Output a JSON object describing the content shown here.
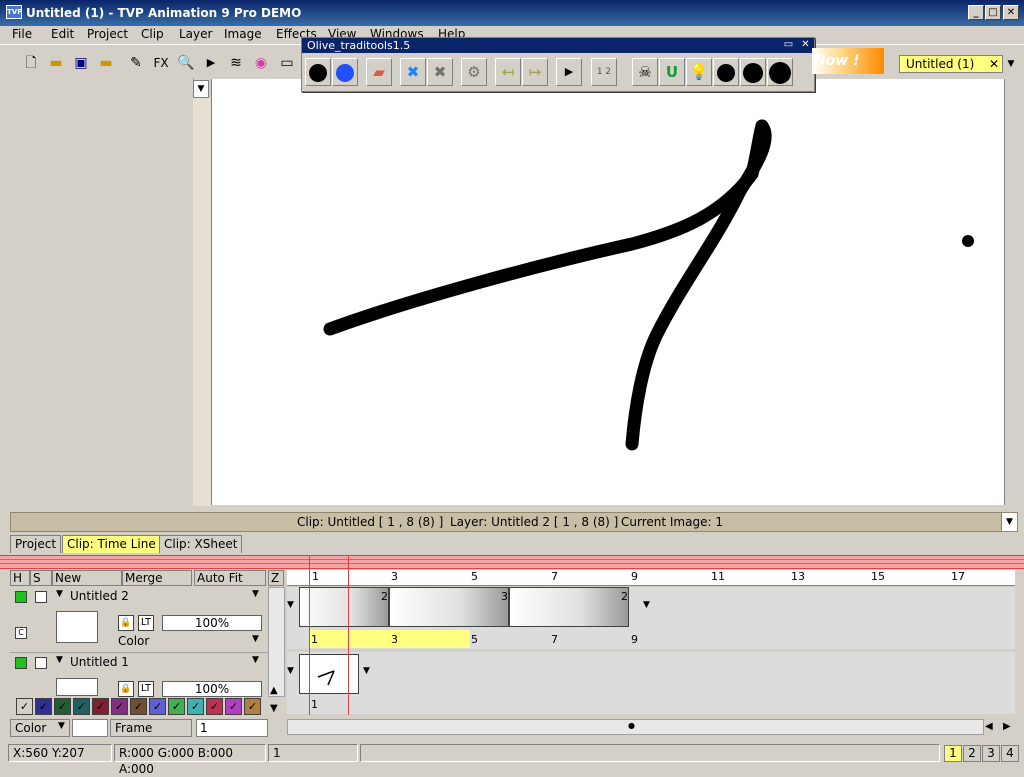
{
  "window": {
    "title": "Untitled (1) - TVP Animation 9 Pro DEMO",
    "app_icon": "TVP"
  },
  "menu": [
    "File",
    "Edit",
    "Project",
    "Clip",
    "Layer",
    "Image",
    "Effects",
    "View",
    "Windows",
    "Help"
  ],
  "toolbar": {
    "fx_label": "FX"
  },
  "float_window": {
    "title": "Olive_traditools1.5"
  },
  "promo": {
    "text": "Now !"
  },
  "project_tab": {
    "label": "Untitled (1)",
    "close": "✕"
  },
  "status": {
    "clip": "Clip: Untitled [ 1 , 8  (8) ]",
    "layer": "Layer: Untitled 2 [ 1 , 8  (8) ]",
    "current": "Current Image: 1"
  },
  "tabs": [
    "Project",
    "Clip: Time Line",
    "Clip: XSheet"
  ],
  "columns": {
    "h": "H",
    "s": "S",
    "new": "New",
    "merge": "Merge",
    "autofit": "Auto Fit",
    "z": "Z"
  },
  "ruler": [
    "1",
    "3",
    "5",
    "7",
    "9",
    "11",
    "13",
    "15",
    "17"
  ],
  "layers": [
    {
      "name": "Untitled 2",
      "opacity": "100%",
      "mode": "Color",
      "lock": "LT",
      "badge": "C",
      "frames": [
        {
          "label": "2"
        },
        {
          "label": "3"
        },
        {
          "label": "2"
        }
      ],
      "numbers": [
        "1",
        "3",
        "5",
        "7",
        "9"
      ]
    },
    {
      "name": "Untitled 1",
      "opacity": "100%",
      "lock": "LT",
      "frame_number": "1"
    }
  ],
  "palette_checks": "✓",
  "bottom_controls": {
    "color_label": "Color",
    "frame_label": "Frame",
    "frame_value": "1"
  },
  "bottom_status": {
    "xy": "X:560  Y:207",
    "rgba": "R:000 G:000 B:000 A:000",
    "value": "1",
    "pages": [
      "1",
      "2",
      "3",
      "4"
    ]
  },
  "colors": {
    "accent": "#ffff80",
    "title_bar": "#0a246a",
    "status_bar": "#c8bea6",
    "timeline_marker": "#e04040"
  }
}
